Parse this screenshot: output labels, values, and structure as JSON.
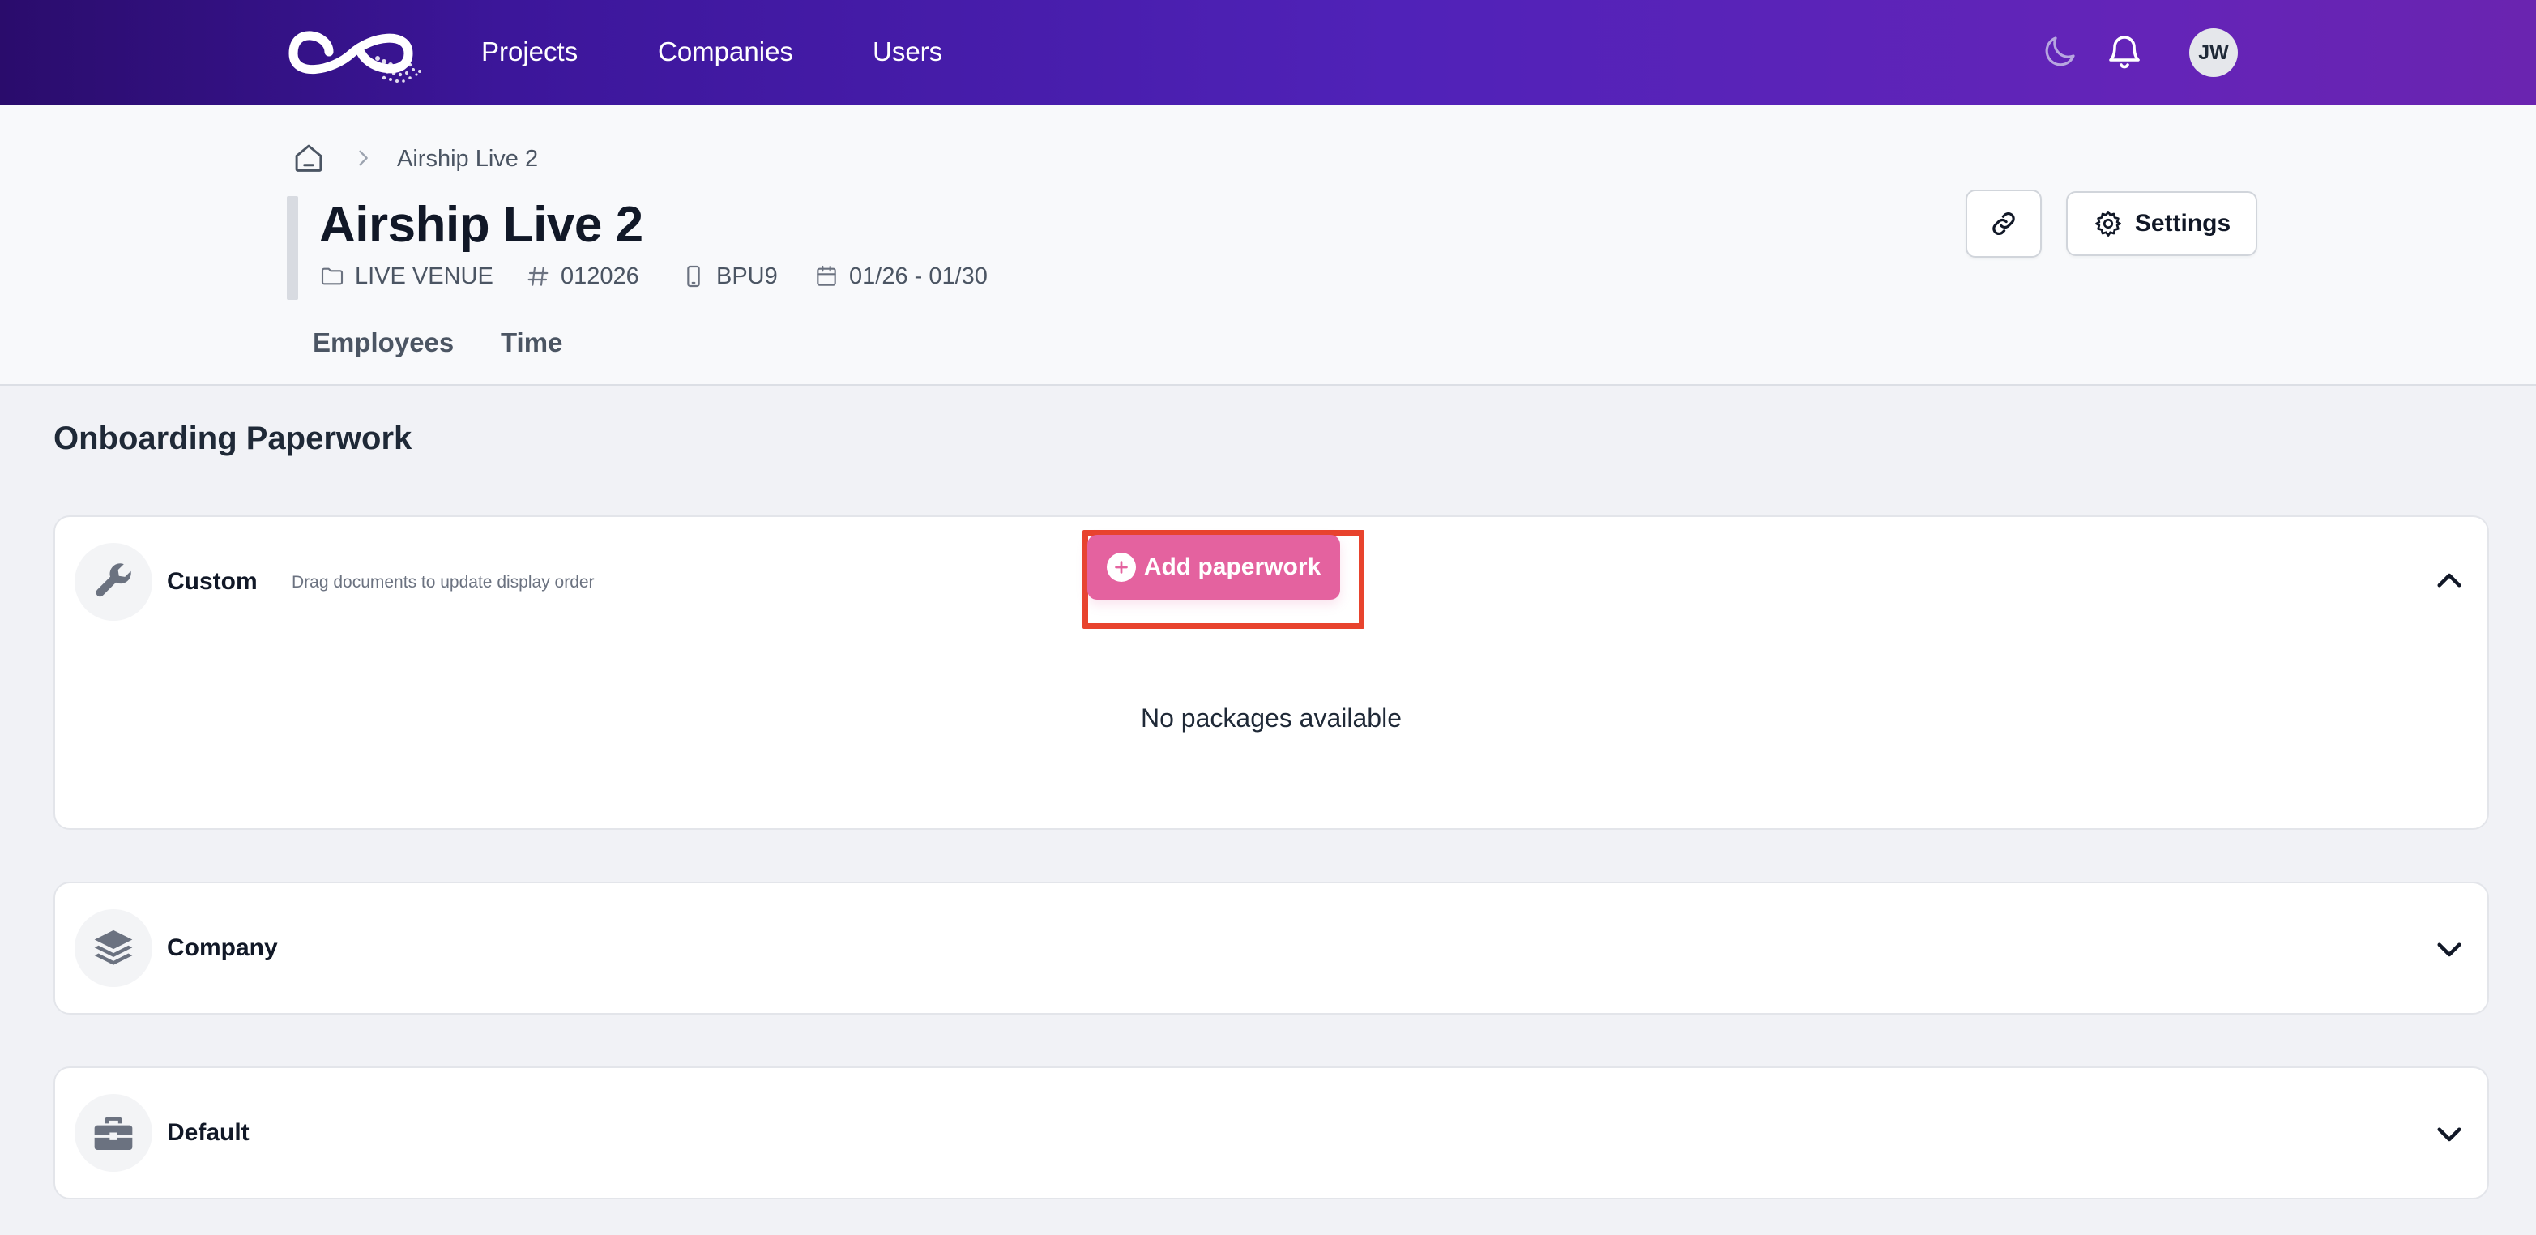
{
  "nav": {
    "links": [
      {
        "label": "Projects"
      },
      {
        "label": "Companies"
      },
      {
        "label": "Users"
      }
    ],
    "user_initials": "JW",
    "icons": {
      "theme": "moon-icon",
      "notifications": "bell-icon"
    }
  },
  "breadcrumb": {
    "home_icon": "home-icon",
    "current": "Airship Live 2"
  },
  "project": {
    "title": "Airship Live 2",
    "meta": {
      "type": "LIVE VENUE",
      "number": "012026",
      "code": "BPU9",
      "dates": "01/26 - 01/30"
    },
    "tabs": [
      {
        "label": "Employees"
      },
      {
        "label": "Time"
      }
    ],
    "actions": {
      "link_icon": "link-icon",
      "settings_label": "Settings"
    }
  },
  "onboarding": {
    "title": "Onboarding Paperwork",
    "sections": [
      {
        "title": "Custom",
        "icon": "wrench-icon",
        "hint": "Drag documents to update display order",
        "add_label": "Add paperwork",
        "empty_message": "No packages available",
        "expanded": true
      },
      {
        "title": "Company",
        "icon": "layers-icon",
        "expanded": false
      },
      {
        "title": "Default",
        "icon": "toolbox-icon",
        "expanded": false
      }
    ]
  },
  "colors": {
    "nav_gradient_start": "#2a0c6c",
    "nav_gradient_end": "#6a24b0",
    "accent_pink": "#e4629f",
    "highlight_red": "#e8432d"
  }
}
